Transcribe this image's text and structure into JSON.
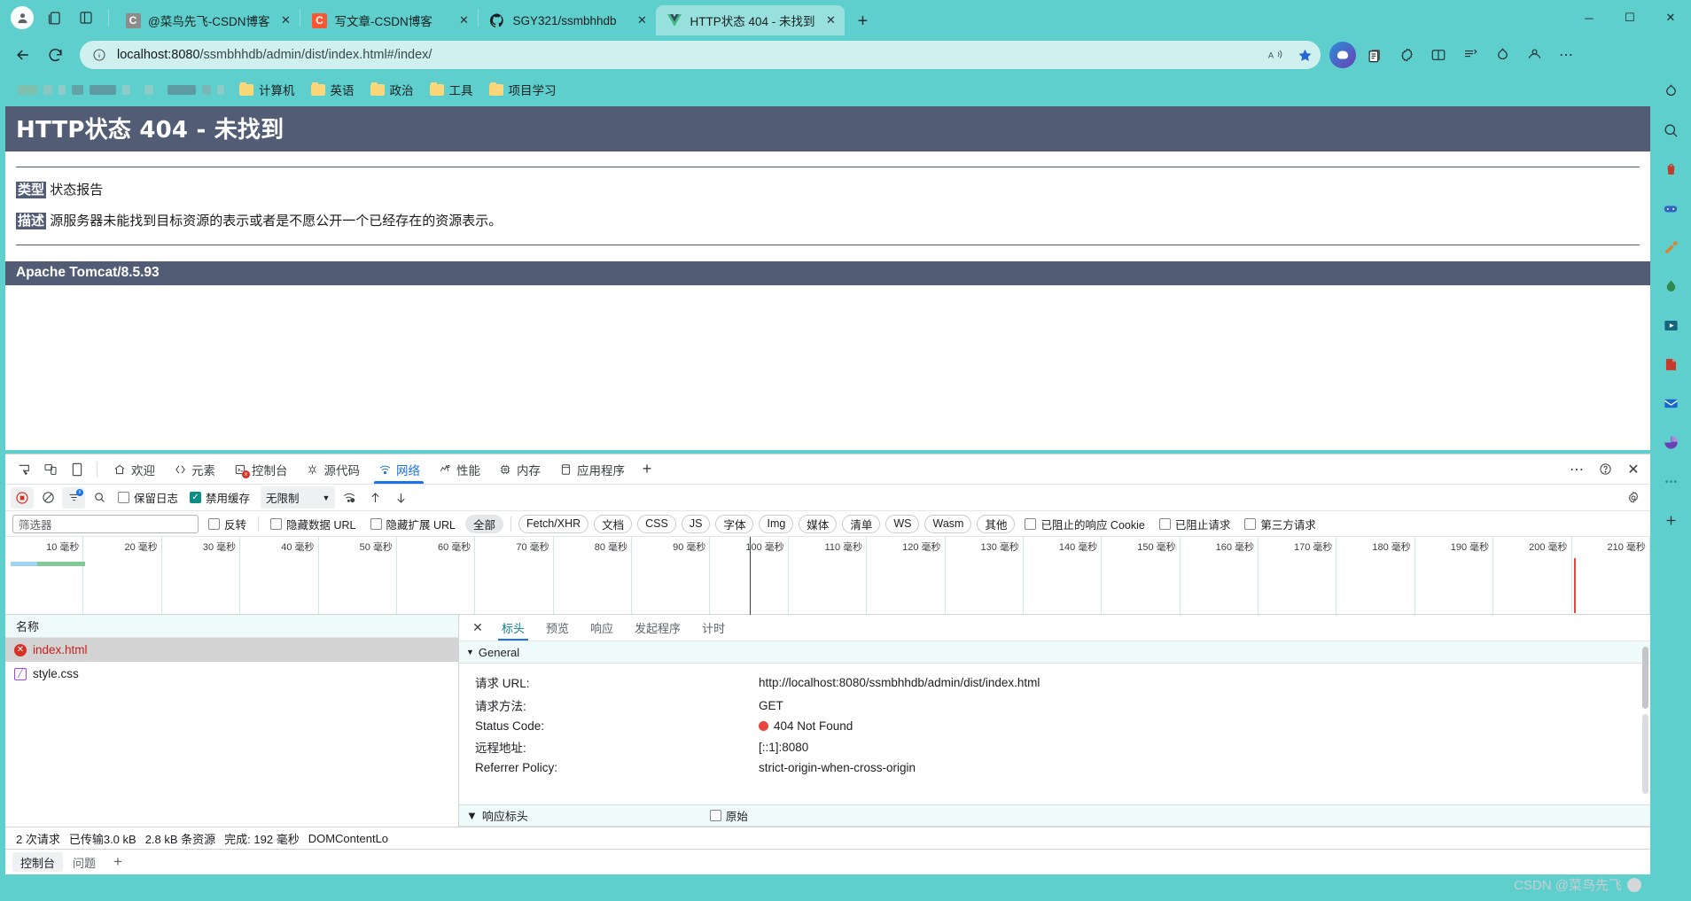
{
  "browser": {
    "window_controls": {
      "minimize": "─",
      "maximize": "☐",
      "close": "✕"
    },
    "tabs": [
      {
        "title": "@菜鸟先飞-CSDN博客",
        "favicon": "csdn-grey-icon",
        "favicon_letter": "C",
        "active": false
      },
      {
        "title": "写文章-CSDN博客",
        "favicon": "csdn-red-icon",
        "favicon_letter": "C",
        "active": false
      },
      {
        "title": "SGY321/ssmbhhdb",
        "favicon": "github-icon",
        "active": false
      },
      {
        "title": "HTTP状态 404 - 未找到",
        "favicon": "vue-icon",
        "active": true
      }
    ],
    "new_tab_label": "+",
    "toolbar": {
      "back": "←",
      "reload": "⟳",
      "info_icon": "info-icon",
      "url_host": "localhost:8080",
      "url_path": "/ssmbhhdb/admin/dist/index.html#/index/",
      "url_full": "localhost:8080/ssmbhhdb/admin/dist/index.html#/index/",
      "read_aloud": "Aᴴ",
      "favorite": "★"
    },
    "bookmarks": [
      {
        "label": "计算机"
      },
      {
        "label": "英语"
      },
      {
        "label": "政治"
      },
      {
        "label": "工具"
      },
      {
        "label": "项目学习"
      }
    ]
  },
  "page": {
    "title": "HTTP状态 404 - 未找到",
    "type_label": "类型",
    "type_value": "状态报告",
    "desc_label": "描述",
    "desc_value": "源服务器未能找到目标资源的表示或者是不愿公开一个已经存在的资源表示。",
    "server": "Apache Tomcat/8.5.93",
    "header_bg": "#525d75"
  },
  "devtools": {
    "panels": [
      {
        "label": "欢迎",
        "icon": "home-icon",
        "active": false
      },
      {
        "label": "元素",
        "icon": "code-icon",
        "active": false
      },
      {
        "label": "控制台",
        "icon": "console-icon",
        "active": false,
        "error_badge": true
      },
      {
        "label": "源代码",
        "icon": "sources-icon",
        "active": false
      },
      {
        "label": "网络",
        "icon": "network-icon",
        "active": true
      },
      {
        "label": "性能",
        "icon": "performance-icon",
        "active": false
      },
      {
        "label": "内存",
        "icon": "memory-icon",
        "active": false
      },
      {
        "label": "应用程序",
        "icon": "application-icon",
        "active": false
      }
    ],
    "panel_add": "+",
    "right_controls": {
      "more": "⋯",
      "help": "?",
      "close": "✕"
    },
    "network_toolbar": {
      "record_icon": "record-stop-icon",
      "clear_icon": "clear-icon",
      "filter_icon": "filter-icon",
      "search_icon": "search-icon",
      "preserve_log": {
        "label": "保留日志",
        "checked": false
      },
      "disable_cache": {
        "label": "禁用缓存",
        "checked": true
      },
      "throttling": "无限制",
      "throttling_arrow": "▼",
      "wifi_icon": "wifi-settings-icon",
      "import_icon": "upload-icon",
      "export_icon": "download-icon",
      "settings_icon": "gear-icon"
    },
    "filter_bar": {
      "placeholder": "筛选器",
      "invert": {
        "label": "反转",
        "checked": false
      },
      "hide_data_urls": {
        "label": "隐藏数据 URL",
        "checked": false
      },
      "hide_ext_urls": {
        "label": "隐藏扩展 URL",
        "checked": false
      },
      "types": [
        "全部",
        "Fetch/XHR",
        "文档",
        "CSS",
        "JS",
        "字体",
        "Img",
        "媒体",
        "清单",
        "WS",
        "Wasm",
        "其他"
      ],
      "active_type": "全部",
      "blocked_cookies": {
        "label": "已阻止的响应 Cookie",
        "checked": false
      },
      "blocked_requests": {
        "label": "已阻止请求",
        "checked": false
      },
      "third_party": {
        "label": "第三方请求",
        "checked": false
      }
    },
    "timeline": {
      "unit": "毫秒",
      "ticks": [
        "10 毫秒",
        "20 毫秒",
        "30 毫秒",
        "40 毫秒",
        "50 毫秒",
        "60 毫秒",
        "70 毫秒",
        "80 毫秒",
        "90 毫秒",
        "100 毫秒",
        "110 毫秒",
        "120 毫秒",
        "130 毫秒",
        "140 毫秒",
        "150 毫秒",
        "160 毫秒",
        "170 毫秒",
        "180 毫秒",
        "190 毫秒",
        "200 毫秒",
        "210 毫秒"
      ]
    },
    "request_list": {
      "column_header": "名称",
      "rows": [
        {
          "name": "index.html",
          "status": "error",
          "icon": "error-icon",
          "selected": true
        },
        {
          "name": "style.css",
          "status": "ok",
          "icon": "stylesheet-icon",
          "selected": false
        }
      ]
    },
    "detail": {
      "close": "✕",
      "tabs": [
        "标头",
        "预览",
        "响应",
        "发起程序",
        "计时"
      ],
      "active_tab": "标头",
      "general_section": "General",
      "general_rows": [
        {
          "key": "请求 URL:",
          "value": "http://localhost:8080/ssmbhhdb/admin/dist/index.html",
          "dot": false
        },
        {
          "key": "请求方法:",
          "value": "GET",
          "dot": false
        },
        {
          "key": "Status Code:",
          "value": "404 Not Found",
          "dot": true
        },
        {
          "key": "远程地址:",
          "value": "[::1]:8080",
          "dot": false
        },
        {
          "key": "Referrer Policy:",
          "value": "strict-origin-when-cross-origin",
          "dot": false
        }
      ],
      "response_section": "响应标头",
      "raw_label": "原始",
      "raw_checked": false
    },
    "status_bar": {
      "requests": "2 次请求",
      "transferred": "已传输3.0 kB",
      "resources": "2.8 kB 条资源",
      "finish": "完成: 192 毫秒",
      "dom": "DOMContentLo"
    },
    "drawer_tabs": [
      "控制台",
      "问题"
    ],
    "drawer_add": "+",
    "active_drawer_tab": "控制台"
  },
  "edge_sidebar": {
    "icons": [
      "copilot-icon",
      "puzzle-icon",
      "search-sidebar-icon",
      "shopping-icon",
      "games-icon",
      "tools-icon",
      "drop-icon",
      "media-icon",
      "office-icon",
      "outlook-icon",
      "chart-icon",
      "more-icon",
      "add-icon"
    ]
  },
  "watermark": {
    "text": "CSDN @菜鸟先飞"
  },
  "colors": {
    "chrome_accent": "#5ecfcd",
    "active_tab": "#97e0de",
    "tomcat_header": "#525d75",
    "error_red": "#d93025",
    "devtools_blue": "#1a73e8",
    "teal_check": "#0b8e83"
  }
}
